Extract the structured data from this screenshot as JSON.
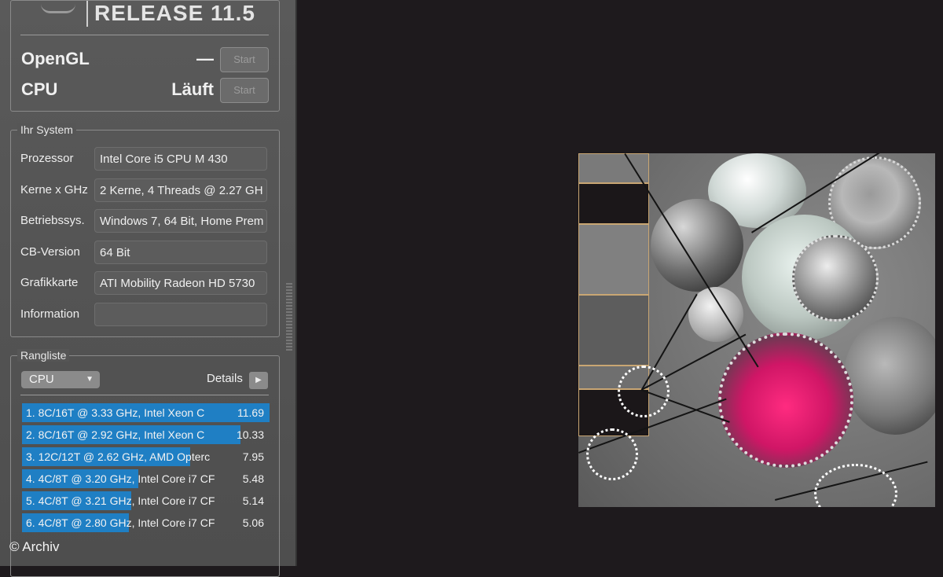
{
  "header": {
    "release": "RELEASE 11.5"
  },
  "tests": [
    {
      "label": "OpenGL",
      "status": "—",
      "button": "Start"
    },
    {
      "label": "CPU",
      "status": "Läuft",
      "button": "Start"
    }
  ],
  "system": {
    "legend": "Ihr System",
    "rows": [
      {
        "label": "Prozessor",
        "value": "Intel Core i5 CPU M 430"
      },
      {
        "label": "Kerne x GHz",
        "value": "2 Kerne, 4 Threads @ 2.27 GH"
      },
      {
        "label": "Betriebssys.",
        "value": "Windows 7, 64 Bit, Home Prem"
      },
      {
        "label": "CB-Version",
        "value": "64 Bit"
      },
      {
        "label": "Grafikkarte",
        "value": "ATI Mobility Radeon HD 5730"
      },
      {
        "label": "Information",
        "value": ""
      }
    ]
  },
  "ranking": {
    "legend": "Rangliste",
    "dropdown": "CPU",
    "details_label": "Details",
    "entries": [
      {
        "text": "1. 8C/16T @ 3.33 GHz, Intel Xeon C",
        "score": "11.69",
        "fill": 1.0
      },
      {
        "text": "2. 8C/16T @ 2.92 GHz, Intel Xeon C",
        "score": "10.33",
        "fill": 0.884
      },
      {
        "text": "3. 12C/12T @ 2.62 GHz, AMD Opterc",
        "score": "7.95",
        "fill": 0.68
      },
      {
        "text": "4. 4C/8T @ 3.20 GHz, Intel Core i7 CF",
        "score": "5.48",
        "fill": 0.469
      },
      {
        "text": "5. 4C/8T @ 3.21 GHz, Intel Core i7 CF",
        "score": "5.14",
        "fill": 0.44
      },
      {
        "text": "6. 4C/8T @ 2.80 GHz, Intel Core i7 CF",
        "score": "5.06",
        "fill": 0.433
      }
    ]
  },
  "footer": {
    "copyright": "© Archiv"
  },
  "colors": {
    "accent": "#1f7fc4",
    "panel": "#555555",
    "viewport": "#1e1a1d"
  }
}
